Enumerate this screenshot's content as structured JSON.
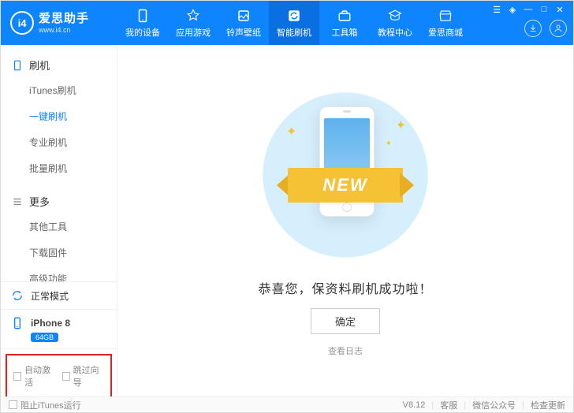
{
  "logo": {
    "badge": "i4",
    "title": "爱思助手",
    "url": "www.i4.cn"
  },
  "nav": [
    {
      "label": "我的设备"
    },
    {
      "label": "应用游戏"
    },
    {
      "label": "铃声壁纸"
    },
    {
      "label": "智能刷机"
    },
    {
      "label": "工具箱"
    },
    {
      "label": "教程中心"
    },
    {
      "label": "爱思商城"
    }
  ],
  "sidebar": {
    "group1": {
      "title": "刷机",
      "items": [
        "iTunes刷机",
        "一键刷机",
        "专业刷机",
        "批量刷机"
      ]
    },
    "group2": {
      "title": "更多",
      "items": [
        "其他工具",
        "下载固件",
        "高级功能"
      ]
    }
  },
  "mode": {
    "label": "正常模式"
  },
  "device": {
    "name": "iPhone 8",
    "storage": "64GB"
  },
  "options": {
    "auto_activate": "自动激活",
    "skip_guide": "跳过向导"
  },
  "main": {
    "ribbon": "NEW",
    "message": "恭喜您，保资料刷机成功啦！",
    "ok": "确定",
    "log": "查看日志"
  },
  "footer": {
    "block_itunes": "阻止iTunes运行",
    "version": "V8.12",
    "support": "客服",
    "wechat": "微信公众号",
    "update": "检查更新"
  }
}
